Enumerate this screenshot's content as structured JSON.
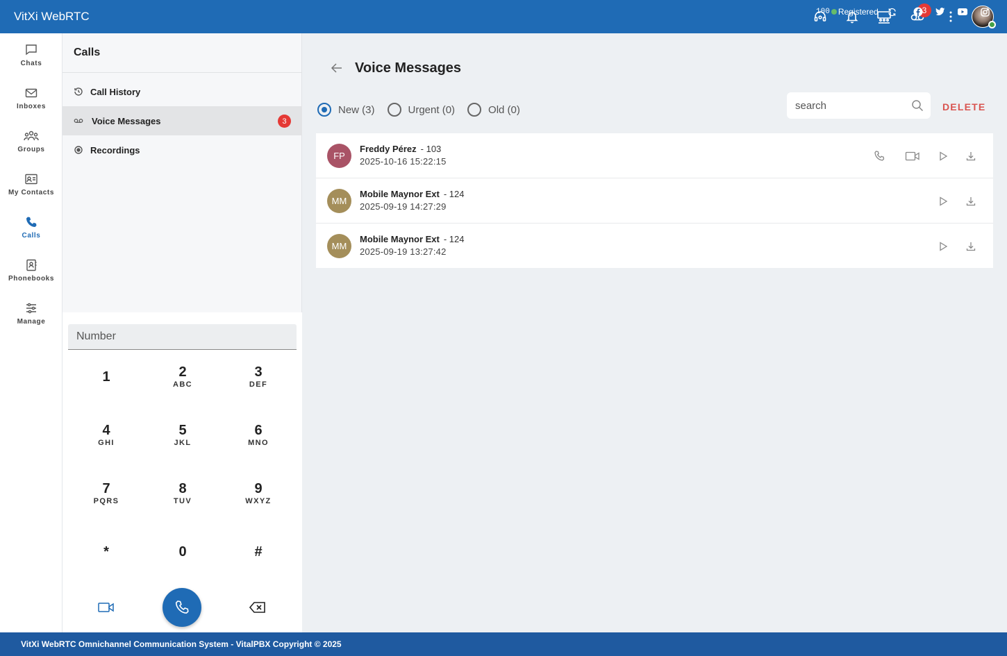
{
  "app": {
    "title": "VitXi WebRTC"
  },
  "topbar": {
    "voicemail_badge": "3",
    "icons": [
      "headset-icon",
      "bell-icon",
      "conference-icon",
      "voicemail-icon",
      "more-vert-icon"
    ]
  },
  "leftnav": {
    "items": [
      {
        "label": "Chats",
        "icon": "chat-icon"
      },
      {
        "label": "Inboxes",
        "icon": "envelope-icon"
      },
      {
        "label": "Groups",
        "icon": "groups-icon"
      },
      {
        "label": "My Contacts",
        "icon": "contact-card-icon"
      },
      {
        "label": "Calls",
        "icon": "phone-icon",
        "active": true
      },
      {
        "label": "Phonebooks",
        "icon": "phonebook-icon"
      },
      {
        "label": "Manage",
        "icon": "sliders-icon"
      }
    ]
  },
  "calls_panel": {
    "title": "Calls",
    "items": [
      {
        "label": "Call History",
        "icon": "history-icon"
      },
      {
        "label": "Voice Messages",
        "icon": "voicemail-icon",
        "badge": "3",
        "selected": true
      },
      {
        "label": "Recordings",
        "icon": "record-icon"
      }
    ]
  },
  "dialer": {
    "placeholder": "Number",
    "keys": [
      {
        "digit": "1",
        "letters": ""
      },
      {
        "digit": "2",
        "letters": "ABC"
      },
      {
        "digit": "3",
        "letters": "DEF"
      },
      {
        "digit": "4",
        "letters": "GHI"
      },
      {
        "digit": "5",
        "letters": "JKL"
      },
      {
        "digit": "6",
        "letters": "MNO"
      },
      {
        "digit": "7",
        "letters": "PQRS"
      },
      {
        "digit": "8",
        "letters": "TUV"
      },
      {
        "digit": "9",
        "letters": "WXYZ"
      },
      {
        "digit": "*",
        "letters": ""
      },
      {
        "digit": "0",
        "letters": ""
      },
      {
        "digit": "#",
        "letters": ""
      }
    ]
  },
  "main": {
    "title": "Voice Messages",
    "filters": [
      {
        "label": "New (3)",
        "checked": true
      },
      {
        "label": "Urgent (0)",
        "checked": false
      },
      {
        "label": "Old (0)",
        "checked": false
      }
    ],
    "search_placeholder": "search",
    "delete_label": "DELETE",
    "messages": [
      {
        "initials": "FP",
        "name": "Freddy Pérez",
        "ext": "- 103",
        "date": "2025-10-16 15:22:15",
        "avatar_color": "#a95366",
        "can_call": true
      },
      {
        "initials": "MM",
        "name": "Mobile Maynor Ext",
        "ext": "- 124",
        "date": "2025-09-19 14:27:29",
        "avatar_color": "#a48e5a",
        "can_call": false
      },
      {
        "initials": "MM",
        "name": "Mobile Maynor Ext",
        "ext": "- 124",
        "date": "2025-09-19 13:27:42",
        "avatar_color": "#a48e5a",
        "can_call": false
      }
    ]
  },
  "footer": {
    "text": "VitXi WebRTC Omnichannel Communication System - VitalPBX Copyright © 2025",
    "extension": "100",
    "status": "Registered"
  },
  "colors": {
    "primary": "#1f6bb5",
    "badge": "#e53935",
    "delete": "#d9534f",
    "online": "#43a047"
  }
}
